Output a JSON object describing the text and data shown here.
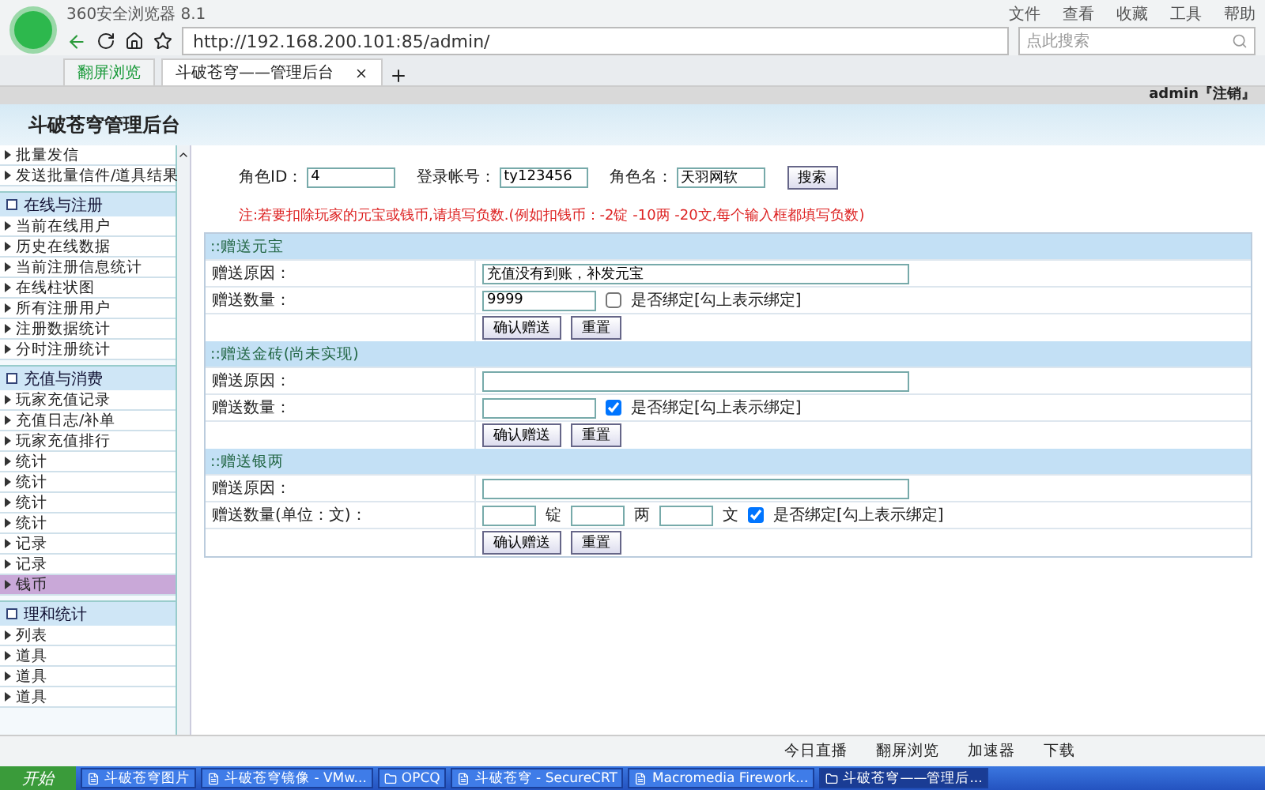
{
  "browser": {
    "title": "360安全浏览器 8.1",
    "menu": [
      "文件",
      "查看",
      "收藏",
      "工具",
      "帮助"
    ],
    "url": "http://192.168.200.101:85/admin/",
    "search_placeholder": "点此搜索",
    "tabs": [
      {
        "label": "翻屏浏览",
        "selected": false
      },
      {
        "label": "斗破苍穹——管理后台",
        "selected": true
      }
    ]
  },
  "page": {
    "user": "admin『注销』",
    "title": "斗破苍穹管理后台"
  },
  "sidebar": {
    "items": [
      {
        "kind": "item",
        "label": "批量发信",
        "selected": false
      },
      {
        "kind": "item",
        "label": "发送批量信件/道具结果",
        "selected": false
      },
      {
        "kind": "section",
        "label": "在线与注册",
        "selected": false
      },
      {
        "kind": "item",
        "label": "当前在线用户",
        "selected": false
      },
      {
        "kind": "item",
        "label": "历史在线数据",
        "selected": false
      },
      {
        "kind": "item",
        "label": "当前注册信息统计",
        "selected": false
      },
      {
        "kind": "item",
        "label": "在线柱状图",
        "selected": false
      },
      {
        "kind": "item",
        "label": "所有注册用户",
        "selected": false
      },
      {
        "kind": "item",
        "label": "注册数据统计",
        "selected": false
      },
      {
        "kind": "item",
        "label": "分时注册统计",
        "selected": false
      },
      {
        "kind": "section",
        "label": "充值与消费",
        "selected": false
      },
      {
        "kind": "item",
        "label": "玩家充值记录",
        "selected": false
      },
      {
        "kind": "item",
        "label": "充值日志/补单",
        "selected": false
      },
      {
        "kind": "item",
        "label": "玩家充值排行",
        "selected": false
      },
      {
        "kind": "item",
        "label": "统计",
        "selected": false
      },
      {
        "kind": "item",
        "label": "统计",
        "selected": false
      },
      {
        "kind": "item",
        "label": "统计",
        "selected": false
      },
      {
        "kind": "item",
        "label": "统计",
        "selected": false
      },
      {
        "kind": "item",
        "label": "记录",
        "selected": false
      },
      {
        "kind": "item",
        "label": "记录",
        "selected": false
      },
      {
        "kind": "item",
        "label": "钱币",
        "selected": true
      },
      {
        "kind": "section",
        "label": "理和统计",
        "selected": false
      },
      {
        "kind": "item",
        "label": "列表",
        "selected": false
      },
      {
        "kind": "item",
        "label": "道具",
        "selected": false
      },
      {
        "kind": "item",
        "label": "道具",
        "selected": false
      },
      {
        "kind": "item",
        "label": "道具",
        "selected": false
      }
    ]
  },
  "search": {
    "fields": [
      {
        "label": "角色ID：",
        "value": "4"
      },
      {
        "label": "登录帐号：",
        "value": "ty123456"
      },
      {
        "label": "角色名：",
        "value": "天羽网软"
      }
    ],
    "button": "搜索"
  },
  "note": "注:若要扣除玩家的元宝或钱币,请填写负数.(例如扣钱币：-2锭 -10两 -20文,每个输入框都填写负数)",
  "sections": [
    {
      "title": "::赠送元宝",
      "rows": [
        {
          "kind": "text",
          "label": "赠送原因：",
          "value": "充值没有到账，补发元宝"
        },
        {
          "kind": "amount",
          "label": "赠送数量：",
          "value": "9999",
          "checkbox": {
            "label": "是否绑定[勾上表示绑定]",
            "checked": false
          }
        },
        {
          "kind": "buttons",
          "buttons": [
            "确认赠送",
            "重置"
          ]
        }
      ]
    },
    {
      "title": "::赠送金砖(尚未实现)",
      "rows": [
        {
          "kind": "text",
          "label": "赠送原因："
        },
        {
          "kind": "amount",
          "label": "赠送数量：",
          "checkbox": {
            "label": "是否绑定[勾上表示绑定]",
            "checked": true
          }
        },
        {
          "kind": "buttons",
          "buttons": [
            "确认赠送",
            "重置"
          ]
        }
      ]
    },
    {
      "title": "::赠送银两",
      "rows": [
        {
          "kind": "text",
          "label": "赠送原因："
        },
        {
          "kind": "coins",
          "label": "赠送数量(单位：文)：",
          "units": [
            "锭",
            "两",
            "文"
          ],
          "checkbox": {
            "label": "是否绑定[勾上表示绑定]",
            "checked": true
          }
        },
        {
          "kind": "buttons",
          "buttons": [
            "确认赠送",
            "重置"
          ]
        }
      ]
    }
  ],
  "status_bar": {
    "items": [
      "今日直播",
      "翻屏浏览",
      "加速器",
      "下载"
    ]
  },
  "taskbar": {
    "start": "开始",
    "items": [
      {
        "label": "斗破苍穹图片",
        "selected": false
      },
      {
        "label": "斗破苍穹镜像 - VMw...",
        "selected": false
      },
      {
        "label": "OPCQ",
        "selected": false
      },
      {
        "label": "斗破苍穹 - SecureCRT",
        "selected": false
      },
      {
        "label": "Macromedia Firework...",
        "selected": false
      },
      {
        "label": "斗破苍穹——管理后...",
        "selected": true
      }
    ]
  }
}
